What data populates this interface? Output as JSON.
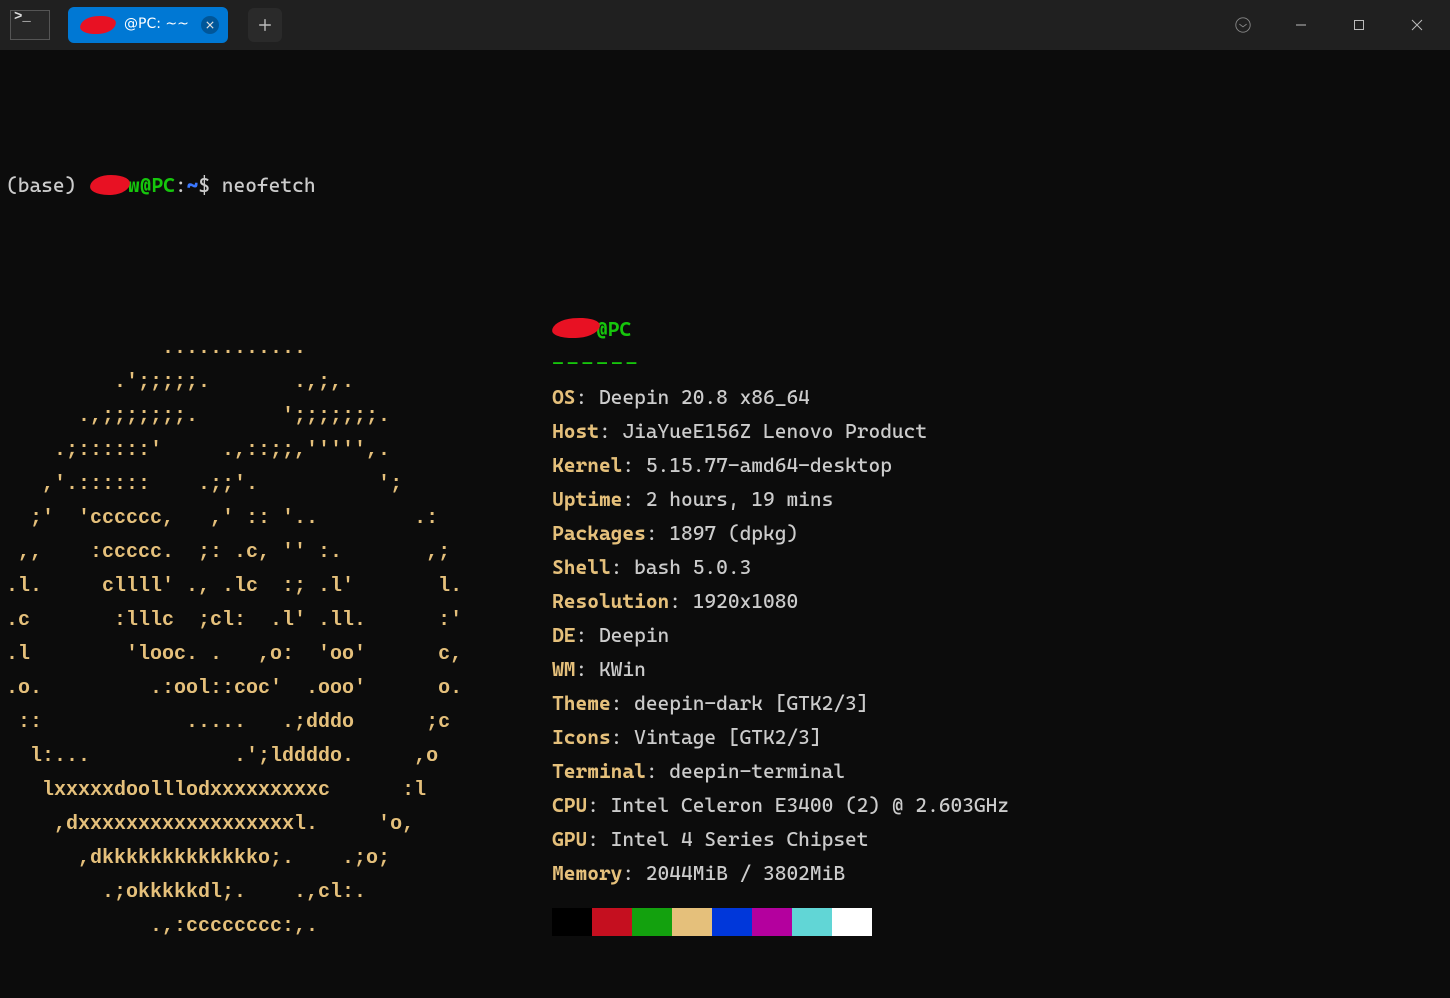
{
  "window": {
    "tab_title": "@PC: ~~",
    "app_icon": "terminal-icon"
  },
  "prompt": {
    "base": "(base) ",
    "user_suffix": "w@PC",
    "path": "~",
    "command": "neofetch"
  },
  "ascii_art": "             ............\n         .';;;;;.       .,;,.\n      .,;;;;;;;.       ';;;;;;;.\n    .;::::::'     .,::;;,''''',.\n   ,'.::::::    .;;'.          ';\n  ;'  'cccccc,   ,' :: '..        .:\n ,,    :ccccc.  ;: .c, '' :.       ,;\n.l.     cllll' ., .lc  :; .l'       l.\n.c       :lllc  ;cl:  .l' .ll.      :'\n.l        'looc. .   ,o:  'oo'      c,\n.o.         .:ool::coc'  .ooo'      o.\n ::            .....   .;dddo      ;c\n  l:...            .';lddddo.     ,o\n   lxxxxxdoolllodxxxxxxxxxc      :l\n    ,dxxxxxxxxxxxxxxxxxxl.     'o,\n      ,dkkkkkkkkkkkkko;.    .;o;\n        .;okkkkkdl;.    .,cl:.\n            .,:cccccccc:,.",
  "neofetch": {
    "header_suffix": "@PC",
    "separator": "------",
    "rows": [
      {
        "key": "OS",
        "val": "Deepin 20.8 x86_64"
      },
      {
        "key": "Host",
        "val": "JiaYueE156Z Lenovo Product"
      },
      {
        "key": "Kernel",
        "val": "5.15.77-amd64-desktop"
      },
      {
        "key": "Uptime",
        "val": "2 hours, 19 mins"
      },
      {
        "key": "Packages",
        "val": "1897 (dpkg)"
      },
      {
        "key": "Shell",
        "val": "bash 5.0.3"
      },
      {
        "key": "Resolution",
        "val": "1920x1080"
      },
      {
        "key": "DE",
        "val": "Deepin"
      },
      {
        "key": "WM",
        "val": "KWin"
      },
      {
        "key": "Theme",
        "val": "deepin-dark [GTK2/3]"
      },
      {
        "key": "Icons",
        "val": "Vintage [GTK2/3]"
      },
      {
        "key": "Terminal",
        "val": "deepin-terminal"
      },
      {
        "key": "CPU",
        "val": "Intel Celeron E3400 (2) @ 2.603GHz"
      },
      {
        "key": "GPU",
        "val": "Intel 4 Series Chipset"
      },
      {
        "key": "Memory",
        "val": "2044MiB / 3802MiB"
      }
    ],
    "swatches": [
      "#000000",
      "#c50f1f",
      "#13a10e",
      "#e5c07b",
      "#0037da",
      "#b4009e",
      "#61d6d6",
      "#ffffff"
    ]
  }
}
